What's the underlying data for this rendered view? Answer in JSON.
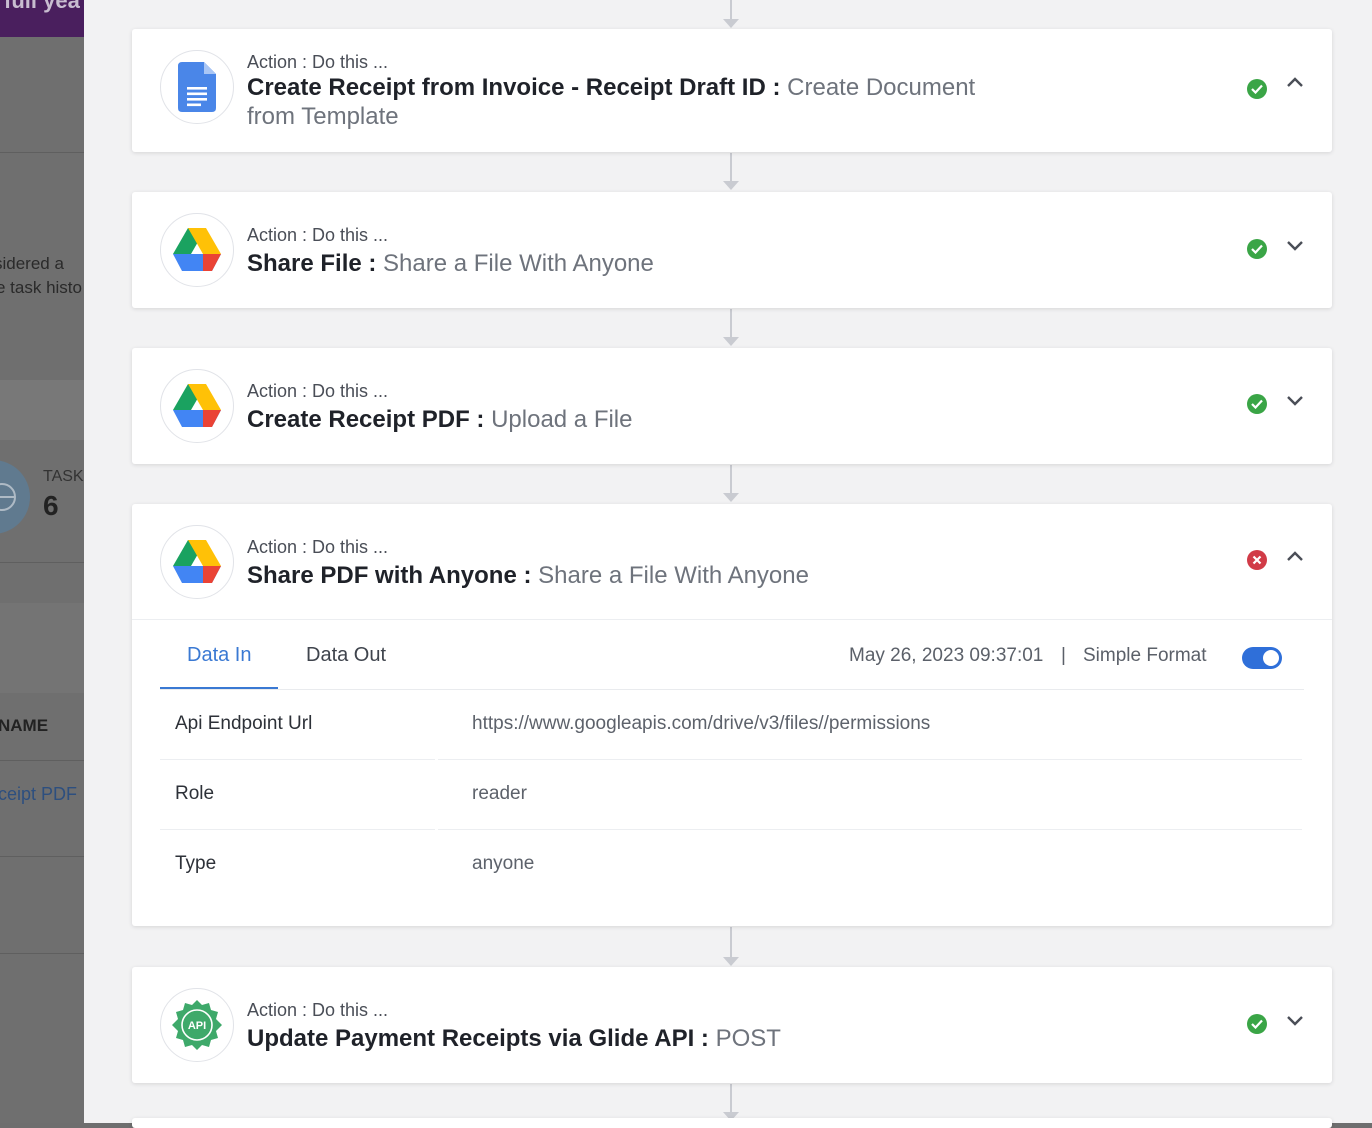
{
  "background": {
    "banner_text": "full yea",
    "snippets": [
      "sidered a",
      "e task histo",
      "TASK",
      "6",
      "NAME",
      "ceipt PDF"
    ]
  },
  "steps": [
    {
      "subtitle": "Action : Do this ...",
      "title": "Create Receipt from Invoice - Receipt Draft ID :",
      "app_action": "Create Document from Template",
      "app_icon": "google-docs-icon",
      "status": "success",
      "expanded": true
    },
    {
      "subtitle": "Action : Do this ...",
      "title": "Share File :",
      "app_action": "Share a File With Anyone",
      "app_icon": "google-drive-icon",
      "status": "success",
      "expanded": false
    },
    {
      "subtitle": "Action : Do this ...",
      "title": "Create Receipt PDF :",
      "app_action": "Upload a File",
      "app_icon": "google-drive-icon",
      "status": "success",
      "expanded": false
    },
    {
      "subtitle": "Action : Do this ...",
      "title": "Share PDF with Anyone :",
      "app_action": "Share a File With Anyone",
      "app_icon": "google-drive-icon",
      "status": "error",
      "expanded": true
    },
    {
      "subtitle": "Action : Do this ...",
      "title": "Update Payment Receipts via Glide API :",
      "app_action": "POST",
      "app_icon": "api-icon",
      "status": "success",
      "expanded": false
    }
  ],
  "details": {
    "tabs": [
      "Data In",
      "Data Out"
    ],
    "active_tab": "Data In",
    "timestamp": "May 26, 2023 09:37:01",
    "separator": "|",
    "format_label": "Simple Format",
    "simple_format_on": true,
    "rows": [
      {
        "key": "Api Endpoint Url",
        "value": "https://www.googleapis.com/drive/v3/files//permissions"
      },
      {
        "key": "Role",
        "value": "reader"
      },
      {
        "key": "Type",
        "value": "anyone"
      }
    ]
  },
  "colors": {
    "success": "#3aa546",
    "error": "#d13b47",
    "accent": "#3a79d3",
    "api_green": "#3ea96a"
  }
}
